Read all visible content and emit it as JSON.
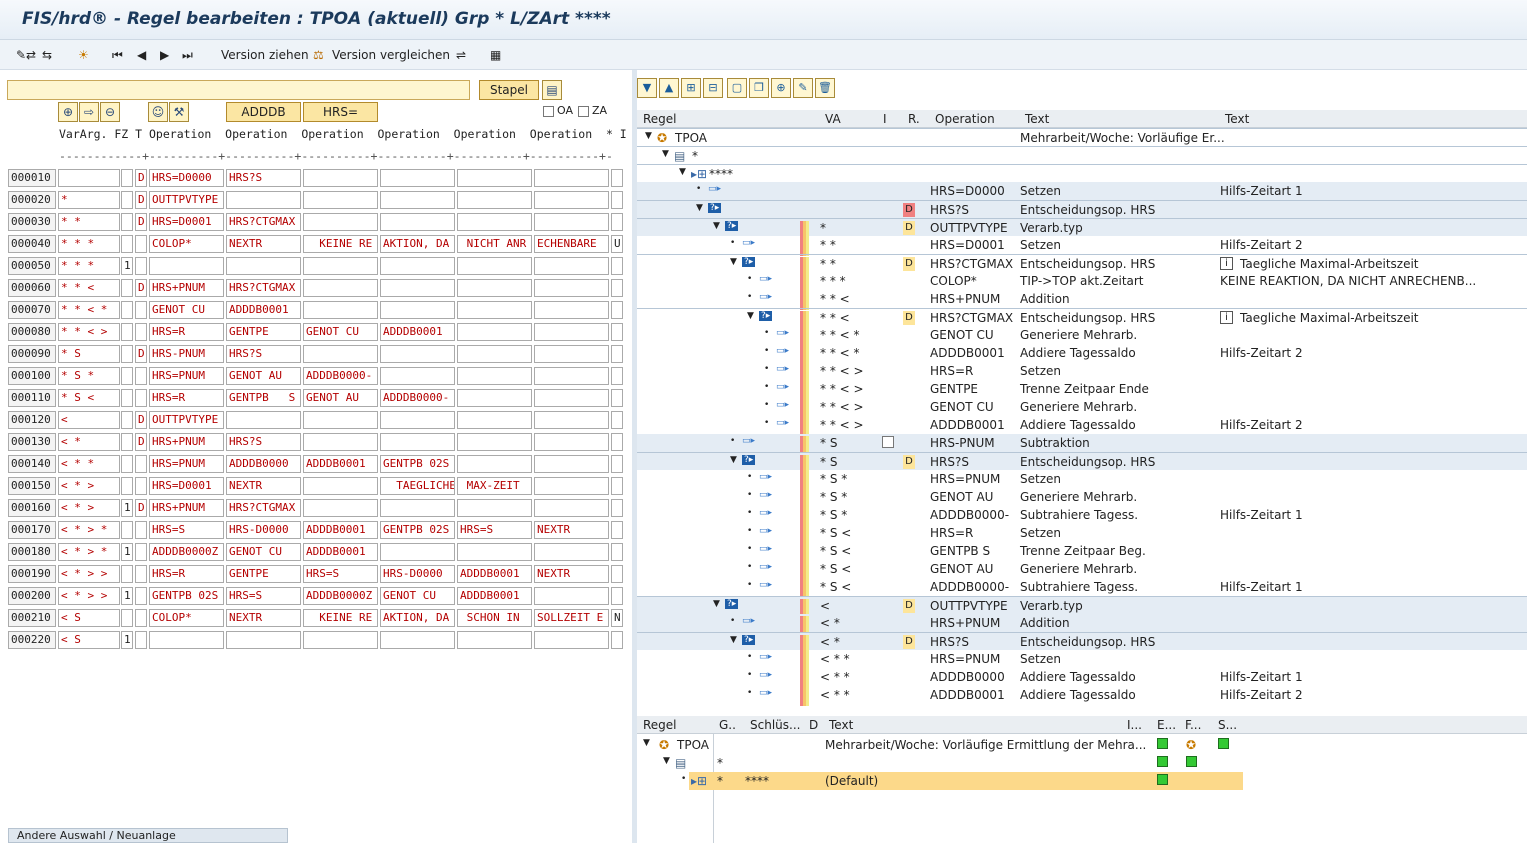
{
  "title": "FIS/hrd® - Regel bearbeiten : TPOA (aktuell)  Grp * L/ZArt ****",
  "toolbar": {
    "version_ziehen": "Version ziehen",
    "version_vergleichen": "Version vergleichen"
  },
  "left": {
    "stapel": "Stapel",
    "adddb": "ADDDB",
    "hrs": "HRS=",
    "oa": "OA",
    "za": "ZA",
    "col_header": "VarArg. FZ T Operation  Operation  Operation  Operation  Operation  Operation  * I",
    "dash_line": "------------+----------+----------+----------+----------+----------+----------+-",
    "rows": [
      {
        "n": "000010",
        "v": "",
        "f": "",
        "t": "D",
        "o": [
          "HRS=D0000",
          "HRS?S",
          "",
          "",
          "",
          ""
        ],
        "x": ""
      },
      {
        "n": "000020",
        "v": "*",
        "f": "",
        "t": "D",
        "o": [
          "OUTTPVTYPE",
          "",
          "",
          "",
          "",
          ""
        ],
        "x": ""
      },
      {
        "n": "000030",
        "v": "* *",
        "f": "",
        "t": "D",
        "o": [
          "HRS=D0001",
          "HRS?CTGMAX",
          "",
          "",
          "",
          ""
        ],
        "x": ""
      },
      {
        "n": "000040",
        "v": "* * *",
        "f": "",
        "t": "",
        "o": [
          "COLOP*",
          "NEXTR",
          "  KEINE RE",
          "AKTION, DA",
          " NICHT ANR",
          "ECHENBARE"
        ],
        "x": "U"
      },
      {
        "n": "000050",
        "v": "* * *",
        "f": "1",
        "t": "",
        "o": [
          "",
          "",
          "",
          "",
          "",
          ""
        ],
        "x": ""
      },
      {
        "n": "000060",
        "v": "* * <",
        "f": "",
        "t": "D",
        "o": [
          "HRS+PNUM",
          "HRS?CTGMAX",
          "",
          "",
          "",
          ""
        ],
        "x": ""
      },
      {
        "n": "000070",
        "v": "* * < *",
        "f": "",
        "t": "",
        "o": [
          "GENOT CU",
          "ADDDB0001",
          "",
          "",
          "",
          ""
        ],
        "x": ""
      },
      {
        "n": "000080",
        "v": "* * < >",
        "f": "",
        "t": "",
        "o": [
          "HRS=R",
          "GENTPE",
          "GENOT CU",
          "ADDDB0001",
          "",
          ""
        ],
        "x": ""
      },
      {
        "n": "000090",
        "v": "* S",
        "f": "",
        "t": "D",
        "o": [
          "HRS-PNUM",
          "HRS?S",
          "",
          "",
          "",
          ""
        ],
        "x": ""
      },
      {
        "n": "000100",
        "v": "* S *",
        "f": "",
        "t": "",
        "o": [
          "HRS=PNUM",
          "GENOT AU",
          "ADDDB0000-",
          "",
          "",
          ""
        ],
        "x": ""
      },
      {
        "n": "000110",
        "v": "* S <",
        "f": "",
        "t": "",
        "o": [
          "HRS=R",
          "GENTPB   S",
          "GENOT AU",
          "ADDDB0000-",
          "",
          ""
        ],
        "x": ""
      },
      {
        "n": "000120",
        "v": "<",
        "f": "",
        "t": "D",
        "o": [
          "OUTTPVTYPE",
          "",
          "",
          "",
          "",
          ""
        ],
        "x": ""
      },
      {
        "n": "000130",
        "v": "< *",
        "f": "",
        "t": "D",
        "o": [
          "HRS+PNUM",
          "HRS?S",
          "",
          "",
          "",
          ""
        ],
        "x": ""
      },
      {
        "n": "000140",
        "v": "< * *",
        "f": "",
        "t": "",
        "o": [
          "HRS=PNUM",
          "ADDDB0000",
          "ADDDB0001",
          "GENTPB 02S",
          "",
          ""
        ],
        "x": ""
      },
      {
        "n": "000150",
        "v": "< * >",
        "f": "",
        "t": "",
        "o": [
          "HRS=D0001",
          "NEXTR",
          "",
          "  TAEGLICHE",
          " MAX-ZEIT",
          ""
        ],
        "x": ""
      },
      {
        "n": "000160",
        "v": "< * >",
        "f": "1",
        "t": "D",
        "o": [
          "HRS+PNUM",
          "HRS?CTGMAX",
          "",
          "",
          "",
          ""
        ],
        "x": ""
      },
      {
        "n": "000170",
        "v": "< * > *",
        "f": "",
        "t": "",
        "o": [
          "HRS=S",
          "HRS-D0000",
          "ADDDB0001",
          "GENTPB 02S",
          "HRS=S",
          "NEXTR"
        ],
        "x": ""
      },
      {
        "n": "000180",
        "v": "< * > *",
        "f": "1",
        "t": "",
        "o": [
          "ADDDB0000Z",
          "GENOT CU",
          "ADDDB0001",
          "",
          "",
          ""
        ],
        "x": ""
      },
      {
        "n": "000190",
        "v": "< * > >",
        "f": "",
        "t": "",
        "o": [
          "HRS=R",
          "GENTPE",
          "HRS=S",
          "HRS-D0000",
          "ADDDB0001",
          "NEXTR"
        ],
        "x": ""
      },
      {
        "n": "000200",
        "v": "< * > >",
        "f": "1",
        "t": "",
        "o": [
          "GENTPB 02S",
          "HRS=S",
          "ADDDB0000Z",
          "GENOT CU",
          "ADDDB0001",
          ""
        ],
        "x": ""
      },
      {
        "n": "000210",
        "v": "< S",
        "f": "",
        "t": "",
        "o": [
          "COLOP*",
          "NEXTR",
          "  KEINE RE",
          "AKTION, DA",
          " SCHON IN",
          "SOLLZEIT E"
        ],
        "x": "N"
      },
      {
        "n": "000220",
        "v": "< S",
        "f": "1",
        "t": "",
        "o": [
          "",
          "",
          "",
          "",
          "",
          ""
        ],
        "x": ""
      }
    ],
    "status": "Andere Auswahl / Neuanlage"
  },
  "tree": {
    "headers": [
      "Regel",
      "VA",
      "I",
      "R.",
      "Operation",
      "Text",
      "Text"
    ],
    "rows": [
      {
        "d": 0,
        "kind": "root",
        "label": "TPOA",
        "va": "",
        "r": "",
        "op": "",
        "t1": "Mehrarbeit/Woche: Vorläufige Er...",
        "t2": ""
      },
      {
        "d": 1,
        "kind": "grp",
        "label": "*",
        "va": "",
        "r": "",
        "op": "",
        "t1": "",
        "t2": ""
      },
      {
        "d": 2,
        "kind": "grp2",
        "label": "****",
        "va": "",
        "r": "",
        "op": "",
        "t1": "",
        "t2": ""
      },
      {
        "d": 3,
        "kind": "leaf",
        "label": "",
        "va": "",
        "r": "",
        "op": "HRS=D0000",
        "t1": "Setzen",
        "t2": "Hilfs-Zeitart 1"
      },
      {
        "d": 3,
        "kind": "dec",
        "label": "",
        "va": "",
        "r": "D",
        "rred": true,
        "op": "HRS?S",
        "t1": "Entscheidungsop. HRS",
        "t2": ""
      },
      {
        "d": 4,
        "kind": "dec",
        "label": "",
        "va": "*",
        "r": "D",
        "op": "OUTTPVTYPE",
        "t1": "Verarb.typ",
        "t2": ""
      },
      {
        "d": 5,
        "kind": "leaf",
        "label": "",
        "va": "* *",
        "r": "",
        "op": "HRS=D0001",
        "t1": "Setzen",
        "t2": "Hilfs-Zeitart 2"
      },
      {
        "d": 5,
        "kind": "dec",
        "label": "",
        "va": "* *",
        "r": "D",
        "op": "HRS?CTGMAX",
        "t1": "Entscheidungsop. HRS",
        "t2": "Taegliche Maximal-Arbeitszeit",
        "info": true
      },
      {
        "d": 6,
        "kind": "leaf",
        "label": "",
        "va": "* * *",
        "r": "",
        "op": "COLOP*",
        "t1": "TIP->TOP akt.Zeitart",
        "t2": "KEINE REAKTION, DA NICHT ANRECHENB..."
      },
      {
        "d": 6,
        "kind": "leaf",
        "label": "",
        "va": "* * <",
        "r": "",
        "op": "HRS+PNUM",
        "t1": "Addition",
        "t2": ""
      },
      {
        "d": 6,
        "kind": "dec",
        "label": "",
        "va": "* * <",
        "r": "D",
        "op": "HRS?CTGMAX",
        "t1": "Entscheidungsop. HRS",
        "t2": "Taegliche Maximal-Arbeitszeit",
        "info": true
      },
      {
        "d": 7,
        "kind": "leaf",
        "label": "",
        "va": "* * < *",
        "r": "",
        "op": "GENOT CU",
        "t1": "Generiere Mehrarb.",
        "t2": ""
      },
      {
        "d": 7,
        "kind": "leaf",
        "label": "",
        "va": "* * < *",
        "r": "",
        "op": "ADDDB0001",
        "t1": "Addiere Tagessaldo",
        "t2": "Hilfs-Zeitart 2"
      },
      {
        "d": 7,
        "kind": "leaf",
        "label": "",
        "va": "* * < >",
        "r": "",
        "op": "HRS=R",
        "t1": "Setzen",
        "t2": ""
      },
      {
        "d": 7,
        "kind": "leaf",
        "label": "",
        "va": "* * < >",
        "r": "",
        "op": "GENTPE",
        "t1": "Trenne Zeitpaar Ende",
        "t2": ""
      },
      {
        "d": 7,
        "kind": "leaf",
        "label": "",
        "va": "* * < >",
        "r": "",
        "op": "GENOT CU",
        "t1": "Generiere Mehrarb.",
        "t2": ""
      },
      {
        "d": 7,
        "kind": "leaf",
        "label": "",
        "va": "* * < >",
        "r": "",
        "op": "ADDDB0001",
        "t1": "Addiere Tagessaldo",
        "t2": "Hilfs-Zeitart 2"
      },
      {
        "d": 5,
        "kind": "leaf",
        "label": "",
        "va": "* S",
        "r": "",
        "op": "HRS-PNUM",
        "t1": "Subtraktion",
        "t2": "",
        "chk": true
      },
      {
        "d": 5,
        "kind": "dec",
        "label": "",
        "va": "* S",
        "r": "D",
        "op": "HRS?S",
        "t1": "Entscheidungsop. HRS",
        "t2": ""
      },
      {
        "d": 6,
        "kind": "leaf",
        "label": "",
        "va": "* S *",
        "r": "",
        "op": "HRS=PNUM",
        "t1": "Setzen",
        "t2": ""
      },
      {
        "d": 6,
        "kind": "leaf",
        "label": "",
        "va": "* S *",
        "r": "",
        "op": "GENOT AU",
        "t1": "Generiere Mehrarb.",
        "t2": ""
      },
      {
        "d": 6,
        "kind": "leaf",
        "label": "",
        "va": "* S *",
        "r": "",
        "op": "ADDDB0000-",
        "t1": "Subtrahiere Tagess.",
        "t2": "Hilfs-Zeitart 1"
      },
      {
        "d": 6,
        "kind": "leaf",
        "label": "",
        "va": "* S <",
        "r": "",
        "op": "HRS=R",
        "t1": "Setzen",
        "t2": ""
      },
      {
        "d": 6,
        "kind": "leaf",
        "label": "",
        "va": "* S <",
        "r": "",
        "op": "GENTPB   S",
        "t1": "Trenne Zeitpaar Beg.",
        "t2": ""
      },
      {
        "d": 6,
        "kind": "leaf",
        "label": "",
        "va": "* S <",
        "r": "",
        "op": "GENOT AU",
        "t1": "Generiere Mehrarb.",
        "t2": ""
      },
      {
        "d": 6,
        "kind": "leaf",
        "label": "",
        "va": "* S <",
        "r": "",
        "op": "ADDDB0000-",
        "t1": "Subtrahiere Tagess.",
        "t2": "Hilfs-Zeitart 1"
      },
      {
        "d": 4,
        "kind": "dec",
        "label": "",
        "va": "<",
        "r": "D",
        "op": "OUTTPVTYPE",
        "t1": "Verarb.typ",
        "t2": ""
      },
      {
        "d": 5,
        "kind": "leaf",
        "label": "",
        "va": "< *",
        "r": "",
        "op": "HRS+PNUM",
        "t1": "Addition",
        "t2": ""
      },
      {
        "d": 5,
        "kind": "dec",
        "label": "",
        "va": "< *",
        "r": "D",
        "op": "HRS?S",
        "t1": "Entscheidungsop. HRS",
        "t2": ""
      },
      {
        "d": 6,
        "kind": "leaf",
        "label": "",
        "va": "< * *",
        "r": "",
        "op": "HRS=PNUM",
        "t1": "Setzen",
        "t2": ""
      },
      {
        "d": 6,
        "kind": "leaf",
        "label": "",
        "va": "< * *",
        "r": "",
        "op": "ADDDB0000",
        "t1": "Addiere Tagessaldo",
        "t2": "Hilfs-Zeitart 1"
      },
      {
        "d": 6,
        "kind": "leaf",
        "label": "",
        "va": "< * *",
        "r": "",
        "op": "ADDDB0001",
        "t1": "Addiere Tagessaldo",
        "t2": "Hilfs-Zeitart 2"
      }
    ]
  },
  "bottom": {
    "headers": [
      "Regel",
      "G..",
      "Schlüs...",
      "D",
      "Text",
      "I...",
      "E...",
      "F...",
      "S..."
    ],
    "rows": [
      {
        "label": "TPOA",
        "g": "",
        "schl": "",
        "d": "",
        "text": "Mehrarbeit/Woche: Vorläufige Ermittlung der Mehra..."
      },
      {
        "label": "",
        "g": "*",
        "schl": "",
        "d": "",
        "text": ""
      },
      {
        "label": "",
        "g": "*",
        "schl": "****",
        "d": "",
        "text": "(Default)"
      }
    ]
  }
}
